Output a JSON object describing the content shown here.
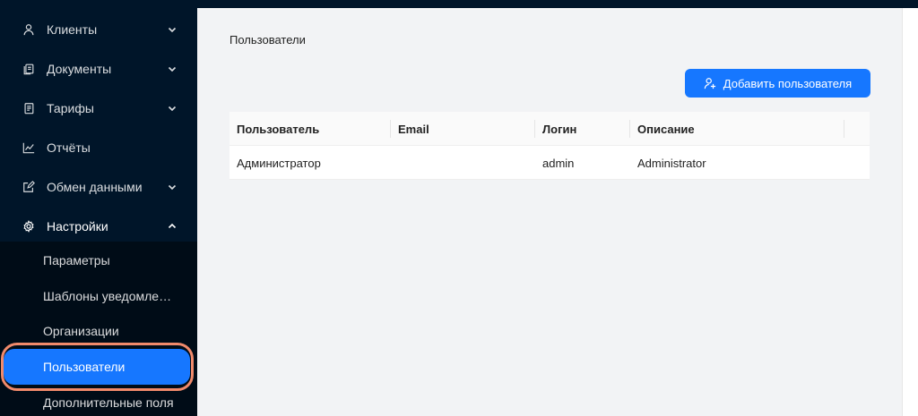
{
  "sidebar": {
    "items": [
      {
        "label": "Клиенты",
        "icon": "user-icon",
        "chevron": "down"
      },
      {
        "label": "Документы",
        "icon": "documents-icon",
        "chevron": "down"
      },
      {
        "label": "Тарифы",
        "icon": "tariffs-icon",
        "chevron": "down"
      },
      {
        "label": "Отчёты",
        "icon": "line-chart-icon",
        "chevron": ""
      },
      {
        "label": "Обмен данными",
        "icon": "edit-square-icon",
        "chevron": "down"
      },
      {
        "label": "Настройки",
        "icon": "gear-icon",
        "chevron": "up"
      }
    ],
    "submenu": [
      {
        "label": "Параметры"
      },
      {
        "label": "Шаблоны уведомлений"
      },
      {
        "label": "Организации"
      },
      {
        "label": "Пользователи",
        "selected": true
      },
      {
        "label": "Дополнительные поля"
      }
    ]
  },
  "main": {
    "title": "Пользователи",
    "add_button_label": "Добавить пользователя",
    "table": {
      "columns": [
        "Пользователь",
        "Email",
        "Логин",
        "Описание"
      ],
      "rows": [
        [
          "Администратор",
          "",
          "admin",
          "Administrator"
        ]
      ]
    }
  },
  "colors": {
    "sidebar_bg": "#001529",
    "submenu_bg": "#000c17",
    "accent": "#1677ff",
    "highlight_ring": "#f08a6b"
  }
}
